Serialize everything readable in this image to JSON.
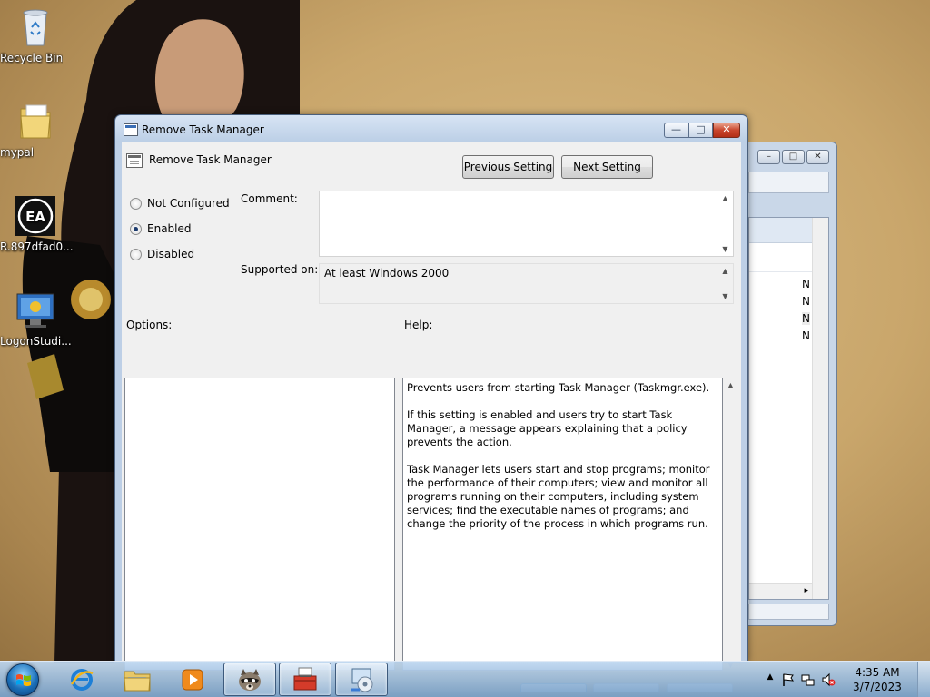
{
  "desktop": {
    "icons": [
      {
        "label": "Recycle Bin",
        "icon": "recycle-bin-icon"
      },
      {
        "label": "mypal",
        "icon": "folder-icon"
      },
      {
        "label": "R.897dfad0...",
        "icon": "ea-app-icon"
      },
      {
        "label": "LogonStudi...",
        "icon": "logon-studio-icon"
      }
    ]
  },
  "background_window": {
    "controls": [
      "–",
      "□",
      "✕"
    ],
    "rows": [
      "N",
      "N",
      "N",
      "N"
    ],
    "scroll_arrow": "▸"
  },
  "dialog": {
    "title": "Remove Task Manager",
    "controls": {
      "minimize": "—",
      "maximize": "□",
      "close": "✕"
    },
    "policy_name": "Remove Task Manager",
    "prev_button": "Previous Setting",
    "next_button": "Next Setting",
    "radio_options": [
      {
        "label": "Not Configured",
        "checked": false
      },
      {
        "label": "Enabled",
        "checked": true
      },
      {
        "label": "Disabled",
        "checked": false
      }
    ],
    "comment_label": "Comment:",
    "comment_value": "",
    "supported_label": "Supported on:",
    "supported_value": "At least Windows 2000",
    "options_label": "Options:",
    "help_label": "Help:",
    "help_paragraphs": [
      "Prevents users from starting Task Manager (Taskmgr.exe).",
      "If this setting is enabled and users try to start Task Manager, a message appears explaining that a policy prevents the action.",
      "Task Manager lets users start and stop programs; monitor the performance of their computers; view and monitor all programs running on their computers, including system services; find the executable names of programs; and change the priority of the process in which programs run."
    ]
  },
  "taskbar": {
    "items": [
      {
        "icon": "internet-explorer-icon",
        "active": false
      },
      {
        "icon": "file-explorer-icon",
        "active": false
      },
      {
        "icon": "media-player-icon",
        "active": false
      },
      {
        "icon": "raccoon-app-icon",
        "active": true
      },
      {
        "icon": "toolbox-icon",
        "active": true
      },
      {
        "icon": "system-app-icon",
        "active": true
      }
    ],
    "clock": {
      "time": "4:35 AM",
      "date": "3/7/2023"
    },
    "tray": {
      "arrow": "▲"
    }
  }
}
